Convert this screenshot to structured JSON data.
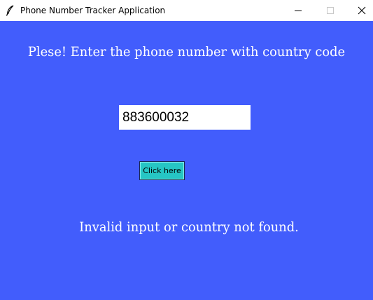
{
  "window": {
    "title": "Phone Number Tracker Application",
    "icon": "feather-icon",
    "controls": [
      "minimize-icon",
      "maximize-icon",
      "close-icon"
    ]
  },
  "main": {
    "prompt": "Plese! Enter the phone number with country code",
    "phone_input_value": "883600032",
    "button_label": "Click here",
    "result_text": "Invalid input or country not found."
  },
  "colors": {
    "background": "#425dfc",
    "button": "#26c6c4",
    "text": "#ffffff"
  }
}
